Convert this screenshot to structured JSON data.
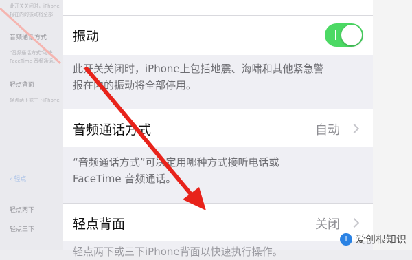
{
  "background": {
    "lines": [
      "此开关关闭时，iPhone",
      "报在内的振动将全部",
      "音频通话方式",
      "\"音频通话方式\"可决",
      "FaceTime 音频通话。",
      "轻点背面",
      "轻点两下或三下iPhone",
      "轻点两下",
      "轻点三下"
    ],
    "back_label": "轻点"
  },
  "settings": {
    "vibration": {
      "label": "振动",
      "enabled": true
    },
    "vibration_footer_line1": "此开关关闭时，iPhone上包括地震、海啸和其他紧急警",
    "vibration_footer_line2": "报在内的振动将全部停用。",
    "audio_call": {
      "label": "音频通话方式",
      "value": "自动"
    },
    "audio_footer_line1": "“音频通话方式”可决定用哪种方式接听电话或",
    "audio_footer_line2": "FaceTime 音频通话。",
    "back_tap": {
      "label": "轻点背面",
      "value": "关闭"
    },
    "back_tap_footer": "轻点两下或三下iPhone背面以快速执行操作。"
  },
  "colors": {
    "toggle_on": "#4cd964",
    "arrow": "#e8231b"
  },
  "watermark": {
    "text": "爱创根知识"
  }
}
